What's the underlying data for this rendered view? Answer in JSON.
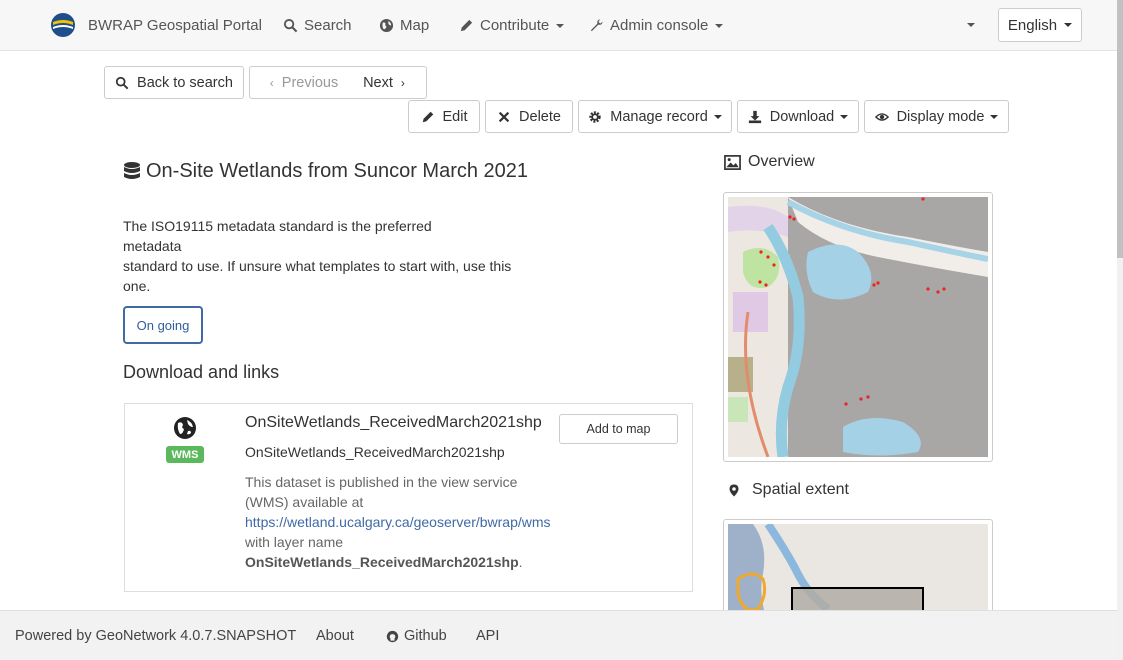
{
  "navbar": {
    "brand": "BWRAP Geospatial Portal",
    "items": [
      {
        "label": "Search",
        "icon": "search-icon"
      },
      {
        "label": "Map",
        "icon": "globe-icon"
      },
      {
        "label": "Contribute",
        "icon": "pencil-icon"
      },
      {
        "label": "Admin console",
        "icon": "wrench-icon"
      }
    ],
    "language": "English"
  },
  "toolbar": {
    "back_label": "Back to search",
    "previous_label": "Previous",
    "next_label": "Next",
    "edit_label": "Edit",
    "delete_label": "Delete",
    "manage_label": "Manage record",
    "download_label": "Download",
    "display_label": "Display mode"
  },
  "record": {
    "title": "On-Site Wetlands from Suncor March 2021",
    "abstract": "The ISO19115 metadata standard is the preferred\nmetadata\nstandard to use. If unsure what templates to start with, use this\none.",
    "status": "On going"
  },
  "links_section": {
    "title": "Download and links",
    "items": [
      {
        "badge": "WMS",
        "title": "OnSiteWetlands_ReceivedMarch2021shp",
        "subtitle": "OnSiteWetlands_ReceivedMarch2021shp",
        "desc_prefix": "This dataset is published in the view service (WMS) available at",
        "url": "https://wetland.ucalgary.ca/geoserver/bwrap/wms",
        "desc_mid": "with layer name",
        "layer": "OnSiteWetlands_ReceivedMarch2021shp",
        "desc_suffix": ".",
        "action": "Add to map"
      }
    ]
  },
  "sidebar": {
    "overview_title": "Overview",
    "extent_title": "Spatial extent"
  },
  "footer": {
    "powered": "Powered by GeoNetwork 4.0.7.SNAPSHOT",
    "about": "About",
    "github": "Github",
    "api": "API"
  }
}
